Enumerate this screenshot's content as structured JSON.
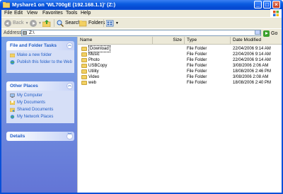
{
  "window": {
    "title": "Myshare1 on 'WL700gE (192.168.1.1)' (Z:)"
  },
  "menu": [
    "File",
    "Edit",
    "View",
    "Favorites",
    "Tools",
    "Help"
  ],
  "toolbar": {
    "back_label": "Back",
    "search_label": "Search",
    "folders_label": "Folders"
  },
  "address": {
    "label": "Address",
    "value": "Z:\\",
    "go_label": "Go"
  },
  "tasks": {
    "file_folder": {
      "title": "File and Folder Tasks",
      "items": [
        "Make a new folder",
        "Publish this folder to the Web"
      ]
    },
    "other_places": {
      "title": "Other Places",
      "items": [
        "My Computer",
        "My Documents",
        "Shared Documents",
        "My Network Places"
      ]
    },
    "details": {
      "title": "Details"
    }
  },
  "list": {
    "columns": [
      "Name",
      "Size",
      "Type",
      "Date Modified"
    ],
    "rows": [
      {
        "name": "Download",
        "type": "File Folder",
        "date": "22/04/2006 9:14 AM"
      },
      {
        "name": "Music",
        "type": "File Folder",
        "date": "22/04/2006 9:14 AM"
      },
      {
        "name": "Photo",
        "type": "File Folder",
        "date": "22/04/2006 9:14 AM"
      },
      {
        "name": "USBCopy",
        "type": "File Folder",
        "date": "3/08/2006 2:06 AM"
      },
      {
        "name": "Utility",
        "type": "File Folder",
        "date": "18/08/2006 2:46 PM"
      },
      {
        "name": "Video",
        "type": "File Folder",
        "date": "3/08/2006 2:08 AM"
      },
      {
        "name": "web",
        "type": "File Folder",
        "date": "18/08/2006 2:40 PM"
      }
    ]
  },
  "colors": {
    "title_bar": "#0a5be0",
    "task_pane": "#7ba2e7",
    "link": "#215dc6",
    "folder": "#f2d063"
  }
}
